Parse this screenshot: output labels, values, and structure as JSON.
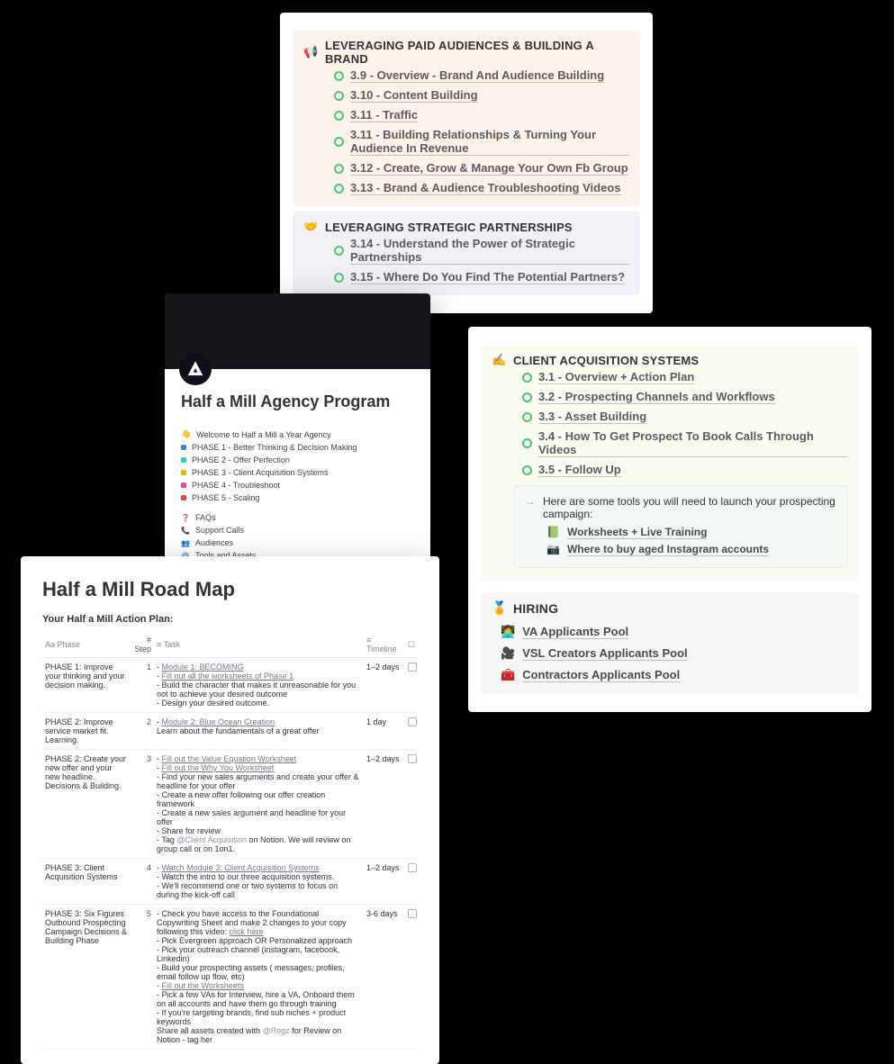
{
  "leverage": {
    "paid": {
      "icon": "📢",
      "title": "LEVERAGING PAID AUDIENCES & BUILDING A BRAND",
      "items": [
        "3.9 - Overview - Brand And Audience Building",
        "3.10 - Content Building",
        "3.11 - Traffic",
        "3.11 - Building Relationships & Turning Your Audience In Revenue",
        "3.12 - Create, Grow & Manage Your Own Fb Group",
        "3.13 - Brand & Audience Troubleshooting Videos"
      ]
    },
    "strategic": {
      "icon": "🤝",
      "title": "LEVERAGING STRATEGIC PARTNERSHIPS",
      "items": [
        "3.14 - Understand the Power of Strategic Partnerships",
        "3.15 - Where Do You Find The Potential Partners?"
      ]
    }
  },
  "program": {
    "title": "Half a Mill Agency Program",
    "welcome": {
      "icon": "👋",
      "text": "Welcome to Half a Mill a Year Agency"
    },
    "phases": [
      {
        "color": "#3b82f6",
        "text": "PHASE 1 - Better Thinking & Decision Making"
      },
      {
        "color": "#2dd4bf",
        "text": "PHASE 2 - Offer Perfection"
      },
      {
        "color": "#eab308",
        "text": "PHASE 3 - Client Acquisition Systems"
      },
      {
        "color": "#ec4899",
        "text": "PHASE 4 - Troubleshoot"
      },
      {
        "color": "#ef4444",
        "text": "PHASE 5 - Scaling"
      }
    ],
    "extras": [
      {
        "icon": "❓",
        "text": "FAQs",
        "color": "#ef4444"
      },
      {
        "icon": "📞",
        "text": "Support Calls"
      },
      {
        "icon": "👥",
        "text": "Audiences"
      },
      {
        "icon": "⚙️",
        "text": "Tools and Assets"
      }
    ]
  },
  "client": {
    "acq": {
      "icon": "✍️",
      "title": "CLIENT ACQUISITION SYSTEMS",
      "items": [
        "3.1 - Overview + Action Plan",
        "3.2 - Prospecting Channels and Workflows",
        "3.3 - Asset Building",
        "3.4 - How To Get Prospect To Book Calls Through Videos",
        "3.5 - Follow Up"
      ],
      "note_intro_arrow": "→",
      "note_intro": "Here are some tools you will need to launch your prospecting campaign:",
      "tools": [
        {
          "icon": "📗",
          "text": "Worksheets + Live Training"
        },
        {
          "icon": "📷",
          "text": "Where to buy aged Instagram accounts"
        }
      ]
    },
    "hiring": {
      "icon": "🏅",
      "title": "HIRING",
      "rows": [
        {
          "icon": "👩‍💻",
          "text": "VA Applicants Pool"
        },
        {
          "icon": "🎥",
          "text": "VSL Creators Applicants Pool"
        },
        {
          "icon": "🧰",
          "text": "Contractors Applicants Pool"
        }
      ]
    }
  },
  "roadmap": {
    "title": "Half a Mill Road Map",
    "subtitle": "Your Half a Mill Action Plan:",
    "headers": {
      "phase": "Phase",
      "step": "Step",
      "task": "Task",
      "timeline": "Timeline"
    },
    "rows": [
      {
        "phase": "PHASE 1: Improve your thinking and your decision making.",
        "step": "1",
        "task_lines": [
          {
            "text": "Module 1: BECOMING",
            "link": true,
            "dash": true
          },
          {
            "text": "Fill out all the worksheets of Phase 1",
            "link": true,
            "dash": true
          },
          {
            "text": "Build the character that makes it unreasonable for you not to achieve your desired outcome",
            "dash": true
          },
          {
            "text": "Design your desired outcome.",
            "dash": true
          }
        ],
        "timeline": "1–2 days"
      },
      {
        "phase": "PHASE 2: Improve service market fit. Learning.",
        "step": "2",
        "task_lines": [
          {
            "text": "Module 2: Blue Ocean Creation",
            "link": true,
            "dash": true
          },
          {
            "text": "Learn about the fundamentals of a great offer"
          }
        ],
        "timeline": "1 day"
      },
      {
        "phase": "PHASE 2: Create your new offer and your new headline. Decisions & Building.",
        "step": "3",
        "task_lines": [
          {
            "text": "Fill out the Value Equation Worksheet",
            "link": true,
            "dash": true
          },
          {
            "text": "Fill out the Why You Worksheet",
            "link": true,
            "dash": true
          },
          {
            "text": "Find your new sales arguments and create your offer & headline for your offer",
            "dash": true
          },
          {
            "text": "Create a new offer following our offer creation framework",
            "dash": true
          },
          {
            "text": "Create a new sales argument and headline for your offer",
            "dash": true
          },
          {
            "text": "Share for review",
            "dash": true
          },
          {
            "prefix": "- Tag ",
            "tag": "@Client Acquisition",
            "suffix": " on Notion. We will review on group call or on 1on1."
          }
        ],
        "timeline": "1–2 days"
      },
      {
        "phase": "PHASE 3: Client Acquisition Systems",
        "step": "4",
        "task_lines": [
          {
            "text": "Watch Module 3: Client Acquisition Systems",
            "link": true,
            "dash": true
          },
          {
            "text": "Watch the intro to our three acquisition systems.",
            "dash": true
          },
          {
            "text": "We'll recommend one or two systems to focus on during the kick-off call",
            "dash": true
          }
        ],
        "timeline": "1–2 days"
      },
      {
        "phase": "PHASE 3: Six Figures Outbound Prospecting Campaign Decisions & Building Phase",
        "step": "5",
        "task_lines": [
          {
            "prefix": "- Check you have access to the Foundational Copywriting Sheet and make 2 changes to your copy following this video: ",
            "linktext": "click here"
          },
          {
            "text": "Pick Evergreen approach OR Personalized approach",
            "dash": true
          },
          {
            "text": "Pick your outreach channel (instagram, facebook, Linkedin)",
            "dash": true
          },
          {
            "text": "Build your prospecting assets ( messages, profiles, email follow up flow, etc)",
            "dash": true
          },
          {
            "text": "Fill out the Worksheets",
            "link": true,
            "dash": true
          },
          {
            "text": "Pick a few VAs for Interview, hire a VA, Onboard them on all accounts and have them go through training",
            "dash": true
          },
          {
            "text": "If you're targeting brands, find sub niches + product keywords",
            "dash": true
          },
          {
            "prefix": "Share all assets created with ",
            "tag": "@Regz",
            "suffix": " for Review on Notion - tag her"
          }
        ],
        "timeline": "3-6 days"
      }
    ]
  }
}
